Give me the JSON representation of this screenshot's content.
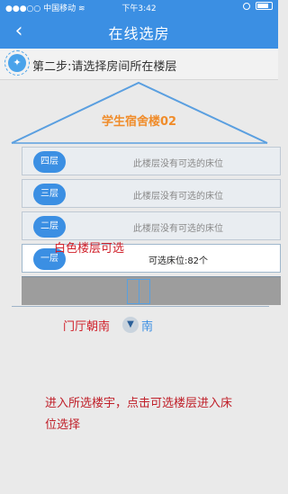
{
  "status_bar": {
    "carrier": "●●●○○ 中国移动",
    "wifi_icon": "wifi-icon",
    "time": "下午3:42",
    "alarm_icon": "alarm-icon",
    "battery_icon": "battery-icon"
  },
  "header": {
    "back_icon": "chevron-left-icon",
    "title": "在线选房",
    "color": "#3b8fe3"
  },
  "step": {
    "icon": "lightbulb-icon",
    "label": "第二步:请选择房间所在楼层"
  },
  "building": {
    "name": "学生宿舍楼02",
    "floors": [
      {
        "label": "四层",
        "status": "此楼层没有可选的床位",
        "available": false
      },
      {
        "label": "三层",
        "status": "此楼层没有可选的床位",
        "available": false
      },
      {
        "label": "二层",
        "status": "此楼层没有可选的床位",
        "available": false
      },
      {
        "label": "一层",
        "status": "可选床位:82个",
        "available": true
      }
    ],
    "door_icon": "door-icon"
  },
  "annotations": {
    "white_floor_note": "白色楼层可选",
    "entrance_label": "门厅朝南",
    "compass_icon": "compass-arrow-icon",
    "direction": "南",
    "instruction": "进入所选楼宇，点击可选楼层进入床位选择"
  }
}
